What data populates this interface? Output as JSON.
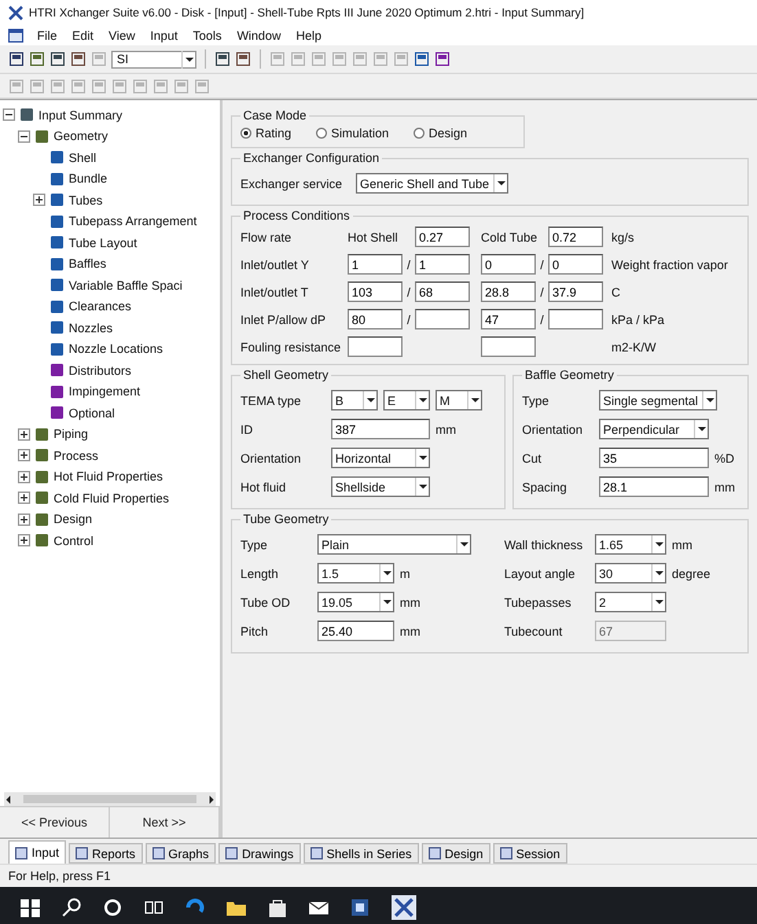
{
  "window": {
    "title": "HTRI Xchanger Suite v6.00 - Disk - [Input] - Shell-Tube Rpts III June 2020 Optimum 2.htri - Input Summary]"
  },
  "menu": [
    "File",
    "Edit",
    "View",
    "Input",
    "Tools",
    "Window",
    "Help"
  ],
  "toolbar": {
    "unit_system": "SI"
  },
  "tree": [
    {
      "label": "Input Summary",
      "expanded": true,
      "children": [
        {
          "label": "Geometry",
          "expanded": true,
          "children": [
            {
              "label": "Shell"
            },
            {
              "label": "Bundle"
            },
            {
              "label": "Tubes",
              "expanded": false
            },
            {
              "label": "Tubepass Arrangement"
            },
            {
              "label": "Tube Layout"
            },
            {
              "label": "Baffles"
            },
            {
              "label": "Variable Baffle Spaci"
            },
            {
              "label": "Clearances"
            },
            {
              "label": "Nozzles"
            },
            {
              "label": "Nozzle Locations"
            },
            {
              "label": "Distributors"
            },
            {
              "label": "Impingement"
            },
            {
              "label": "Optional"
            }
          ]
        },
        {
          "label": "Piping",
          "expanded": false
        },
        {
          "label": "Process",
          "expanded": false
        },
        {
          "label": "Hot Fluid Properties",
          "expanded": false
        },
        {
          "label": "Cold Fluid Properties",
          "expanded": false
        },
        {
          "label": "Design",
          "expanded": false
        },
        {
          "label": "Control",
          "expanded": false
        }
      ]
    }
  ],
  "nav_buttons": [
    "<< Previous",
    "Next >>"
  ],
  "case_mode": {
    "title": "Case Mode",
    "options": [
      {
        "label": "Rating",
        "selected": true
      },
      {
        "label": "Simulation",
        "selected": false
      },
      {
        "label": "Design",
        "selected": false
      }
    ]
  },
  "exchanger_configuration": {
    "title": "Exchanger Configuration",
    "label": "Exchanger service",
    "value": "Generic Shell and Tube"
  },
  "process_conditions": {
    "title": "Process Conditions",
    "rows": [
      {
        "kind": "flow",
        "label": "Flow rate",
        "hot_label": "Hot Shell",
        "hot": "0.27",
        "cold_label": "Cold Tube",
        "cold": "0.72",
        "units": [
          "kg/s"
        ]
      },
      {
        "kind": "pair",
        "label": "Inlet/outlet Y",
        "hot_in": "1",
        "hot_out": "1",
        "cold_in": "0",
        "cold_out": "0",
        "separators": [
          "/",
          "/"
        ],
        "units": [
          "Weight fraction vapor"
        ]
      },
      {
        "kind": "pair",
        "label": "Inlet/outlet T",
        "hot_in": "103",
        "hot_out": "68",
        "cold_in": "28.8",
        "cold_out": "37.9",
        "separators": [
          "/",
          "/"
        ],
        "units": [
          "C"
        ]
      },
      {
        "kind": "pair",
        "label": "Inlet P/allow dP",
        "hot_in": "80",
        "cold_in": "47",
        "separators": [
          "/",
          "/"
        ],
        "units": [
          "kPa",
          "/",
          "kPa"
        ]
      },
      {
        "kind": "single",
        "label": "Fouling resistance",
        "units": [
          "m2-K/W"
        ]
      }
    ]
  },
  "shell_geometry": {
    "title": "Shell Geometry",
    "rows": [
      {
        "kind": "multi_select",
        "label": "TEMA type",
        "values": [
          "B",
          "E",
          "M"
        ]
      },
      {
        "kind": "input",
        "label": "ID",
        "value": "387",
        "unit": "mm",
        "disabled": false
      },
      {
        "kind": "select",
        "label": "Orientation",
        "value": "Horizontal"
      },
      {
        "kind": "select",
        "label": "Hot fluid",
        "value": "Shellside"
      }
    ]
  },
  "baffle_geometry": {
    "title": "Baffle Geometry",
    "rows": [
      {
        "kind": "select",
        "label": "Type",
        "value": "Single segmental"
      },
      {
        "kind": "select",
        "label": "Orientation",
        "value": "Perpendicular"
      },
      {
        "kind": "input",
        "label": "Cut",
        "value": "35",
        "unit": "%D",
        "disabled": false
      },
      {
        "kind": "input",
        "label": "Spacing",
        "value": "28.1",
        "unit": "mm",
        "disabled": false
      }
    ]
  },
  "tube_geometry": {
    "title": "Tube Geometry",
    "left": [
      {
        "kind": "select",
        "label": "Type",
        "value": "Plain"
      },
      {
        "kind": "select",
        "label": "Length",
        "value": "1.5",
        "unit": "m"
      },
      {
        "kind": "select",
        "label": "Tube OD",
        "value": "19.05",
        "unit": "mm"
      },
      {
        "kind": "input",
        "label": "Pitch",
        "value": "25.40",
        "unit": "mm",
        "disabled": false
      }
    ],
    "right": [
      {
        "kind": "select",
        "label": "Wall thickness",
        "value": "1.65",
        "unit": "mm"
      },
      {
        "kind": "select",
        "label": "Layout angle",
        "value": "30",
        "unit": "degree"
      },
      {
        "kind": "select",
        "label": "Tubepasses",
        "value": "2"
      },
      {
        "kind": "input",
        "label": "Tubecount",
        "value": "67",
        "disabled": true
      }
    ]
  },
  "tabs": [
    {
      "label": "Input",
      "selected": true
    },
    {
      "label": "Reports",
      "selected": false
    },
    {
      "label": "Graphs",
      "selected": false
    },
    {
      "label": "Drawings",
      "selected": false
    },
    {
      "label": "Shells in Series",
      "selected": false
    },
    {
      "label": "Design",
      "selected": false
    },
    {
      "label": "Session",
      "selected": false
    }
  ],
  "status_bar": "For Help, press F1"
}
